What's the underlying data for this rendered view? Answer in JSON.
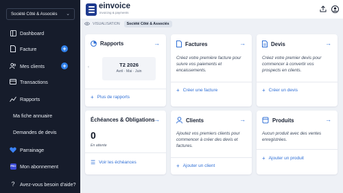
{
  "sidebar": {
    "company": "Société Côté & Associés",
    "items": [
      {
        "label": "Dashboard",
        "icon": "dashboard-icon"
      },
      {
        "label": "Facture",
        "icon": "invoice-icon"
      },
      {
        "label": "Mes clients",
        "icon": "clients-icon"
      },
      {
        "label": "Transactions",
        "icon": "card-icon"
      },
      {
        "label": "Rapports",
        "icon": "chart-icon"
      },
      {
        "label": "Ma fiche annuaire"
      },
      {
        "label": "Demandes de devis"
      },
      {
        "label": "Parrainage",
        "icon": "heart-icon"
      },
      {
        "label": "Mon abonnement",
        "icon": "pro-badge",
        "badge": "PRO"
      },
      {
        "label": "Avez-vous besoin d'aide?",
        "icon": "help-icon"
      }
    ]
  },
  "header": {
    "brand": "einvoice",
    "tagline": "invoicing & payments"
  },
  "breadcrumb": {
    "section": "VISUALISATION",
    "current": "Société Côté & Associés"
  },
  "cards": {
    "rapports": {
      "title": "Rapports",
      "quarter": "T2 2026",
      "months": "Avril · Mai · Juin",
      "link": "Plus de rapports"
    },
    "factures": {
      "title": "Factures",
      "body": "Créez votre première facture pour suivre vos paiements et encaissements.",
      "link": "Créer une facture"
    },
    "devis": {
      "title": "Devis",
      "body": "Créez votre premier devis pour commencer à convertir vos prospects en clients.",
      "link": "Créer un devis"
    },
    "echeances": {
      "title": "Échéances & Obligations",
      "count": "0",
      "status": "En attente",
      "link": "Voir les échéances"
    },
    "clients": {
      "title": "Clients",
      "body": "Ajoutez vos premiers clients pour commencer à créer des devis et factures.",
      "link": "Ajouter un client"
    },
    "produits": {
      "title": "Produits",
      "body": "Aucun produit avec des ventes enregistrées.",
      "link": "Ajouter un produit"
    }
  },
  "colors": {
    "sidebar_bg": "#161c2b",
    "accent": "#2f6fd6",
    "page_bg": "#eef1f6"
  }
}
